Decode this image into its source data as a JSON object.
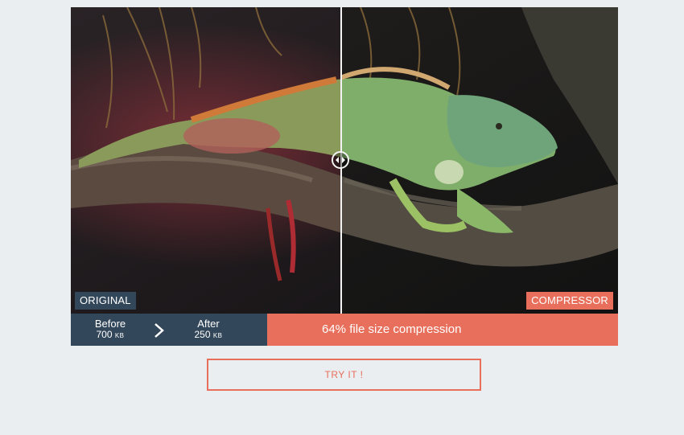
{
  "labels": {
    "original": "ORIGINAL",
    "compressor": "COMPRESSOR"
  },
  "stats": {
    "before_label": "Before",
    "before_value": "700",
    "before_unit": "KB",
    "after_label": "After",
    "after_value": "250",
    "after_unit": "KB",
    "compression_text": "64% file size compression"
  },
  "cta": {
    "label": "TRY IT !"
  },
  "colors": {
    "accent": "#e76f5b",
    "panel": "#33475a",
    "background": "#eaeef1"
  }
}
